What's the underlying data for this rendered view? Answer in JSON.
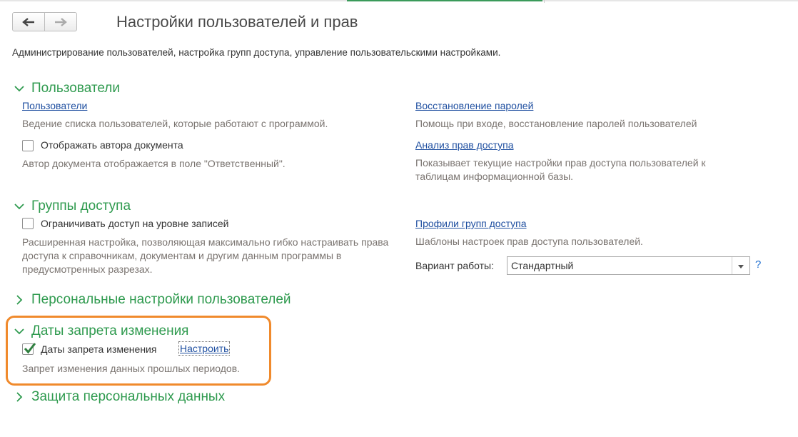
{
  "window": {
    "title": "Настройки пользователей и прав",
    "subtitle": "Администрирование пользователей, настройка групп доступа, управление пользовательскими настройками."
  },
  "nav": {
    "back_icon": "arrow-left-icon",
    "forward_icon": "arrow-right-icon"
  },
  "sections": {
    "users": {
      "title": "Пользователи",
      "expanded": true,
      "users_link": "Пользователи",
      "users_hint": "Ведение списка пользователей, которые работают с программой.",
      "author_checkbox_label": "Отображать автора документа",
      "author_checked": false,
      "author_hint": "Автор документа отображается в поле \"Ответственный\".",
      "password_link": "Восстановление паролей",
      "password_hint": "Помощь при входе, восстановление паролей пользователей",
      "rights_link": "Анализ прав доступа",
      "rights_hint": "Показывает текущие настройки прав доступа пользователей к таблицам информационной базы."
    },
    "access_groups": {
      "title": "Группы доступа",
      "expanded": true,
      "restrict_checkbox_label": "Ограничивать доступ на уровне записей",
      "restrict_checked": false,
      "restrict_hint": "Расширенная настройка, позволяющая максимально гибко настраивать права доступа к справочникам, документам и другим данным программы в предусмотренных разрезах.",
      "profiles_link": "Профили групп доступа",
      "profiles_hint": "Шаблоны настроек прав доступа пользователей.",
      "mode_label": "Вариант работы:",
      "mode_value": "Стандартный",
      "help_label": "?"
    },
    "personal_settings": {
      "title": "Персональные настройки пользователей",
      "expanded": false
    },
    "change_dates": {
      "title": "Даты запрета изменения",
      "expanded": true,
      "checkbox_label": "Даты запрета изменения",
      "checked": true,
      "configure_link": "Настроить",
      "hint": "Запрет изменения данных прошлых периодов."
    },
    "personal_data": {
      "title": "Защита персональных данных",
      "expanded": false
    }
  },
  "colors": {
    "section_green": "#2e9a4e",
    "link_blue": "#1f4fa0",
    "hint_gray": "#7a7470",
    "highlight_orange": "#f08a2c"
  }
}
